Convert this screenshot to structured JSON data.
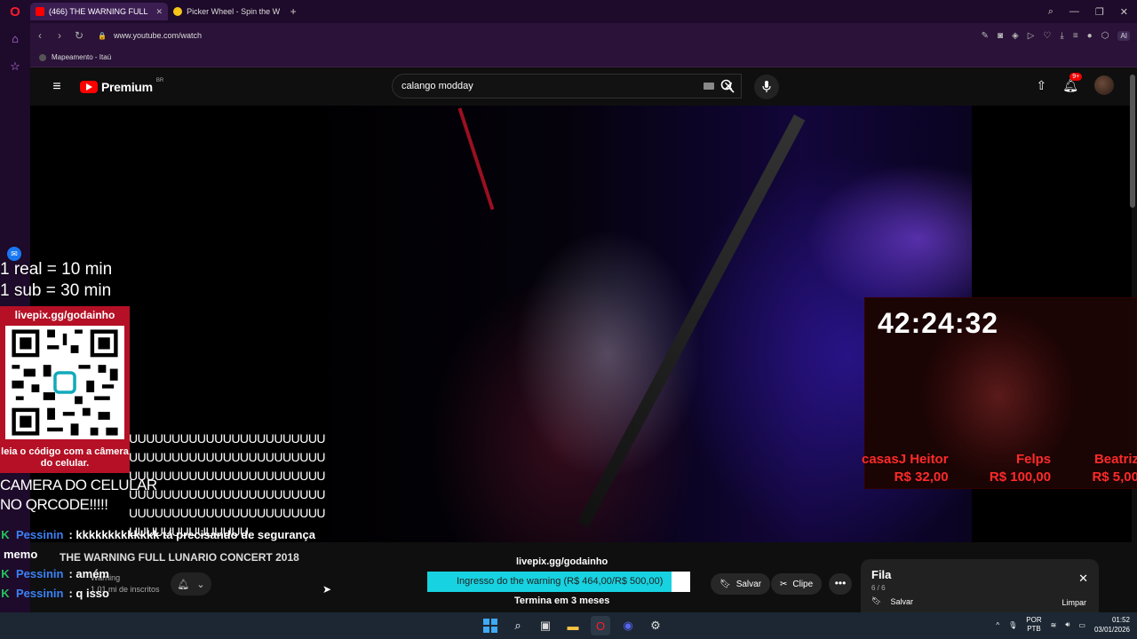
{
  "browser": {
    "tabs": [
      {
        "label": "(466) THE WARNING FULL",
        "active": true,
        "favicon_color": "#ff0000"
      },
      {
        "label": "Picker Wheel - Spin the W",
        "active": false,
        "favicon_color": "#f5c518"
      }
    ],
    "url": "www.youtube.com/watch",
    "ai_label": "AI",
    "bookmark": "Mapeamento - Itaú"
  },
  "youtube": {
    "brand": "Premium",
    "region": "BR",
    "search_value": "calango modday",
    "notification_badge": "9+"
  },
  "overlay": {
    "promo_lines": [
      "1 real = 10 min",
      "1 sub = 30 min"
    ],
    "qr_link": "livepix.gg/godainho",
    "qr_caption": "leia o código com a câmera do celular.",
    "spam_text": "UUUUUUUUUUUUUUUUUUUUUUUUUUUUUUUUUUUUUUUUUUUUUUUUUUUUUUUUUUUUUUUUUUUUUUUUUUUUUUUUUUUUUUUUUUUUUUUUUUUUUUUUUUUUUUUUUUUUUUUUUUUUUUUUU",
    "spam_overlap_1": "CAMERA DO CELULAR",
    "spam_overlap_2": "NO QRCODE!!!!!",
    "timer": "42:24:32",
    "donors": [
      {
        "name": "casasJ Heitor",
        "value": "R$ 32,00"
      },
      {
        "name": "Felps",
        "value": "R$ 100,00"
      },
      {
        "name": "Beatriz",
        "value": "R$ 5,00"
      }
    ],
    "chat": [
      {
        "user": "Pessinin",
        "text": ": kkkkkkkkkkkkk tá precisando de segurança"
      },
      {
        "user": "",
        "text": "memo"
      },
      {
        "user": "Pessinin",
        "text": ": amém"
      },
      {
        "user": "Pessinin",
        "text": ": q isso"
      }
    ]
  },
  "below_video": {
    "title": "THE WARNING FULL LUNARIO CONCERT 2018",
    "channel_name": "Warning",
    "subscribers": "1,01 mi de inscritos",
    "livepix_label": "livepix.gg/godainho",
    "goal_text": "Ingresso do the warning (R$ 464,00/R$ 500,00)",
    "goal_fraction": 0.928,
    "goal_sub": "Termina em 3 meses",
    "save_label": "Salvar",
    "clip_label": "Clipe",
    "more_label": "•••"
  },
  "queue": {
    "title": "Fila",
    "count": "6 / 6",
    "save_label": "Salvar",
    "clear_label": "Limpar"
  },
  "taskbar": {
    "lang_1": "POR",
    "lang_2": "PTB",
    "time": "01:52",
    "date": "03/01/2026"
  }
}
